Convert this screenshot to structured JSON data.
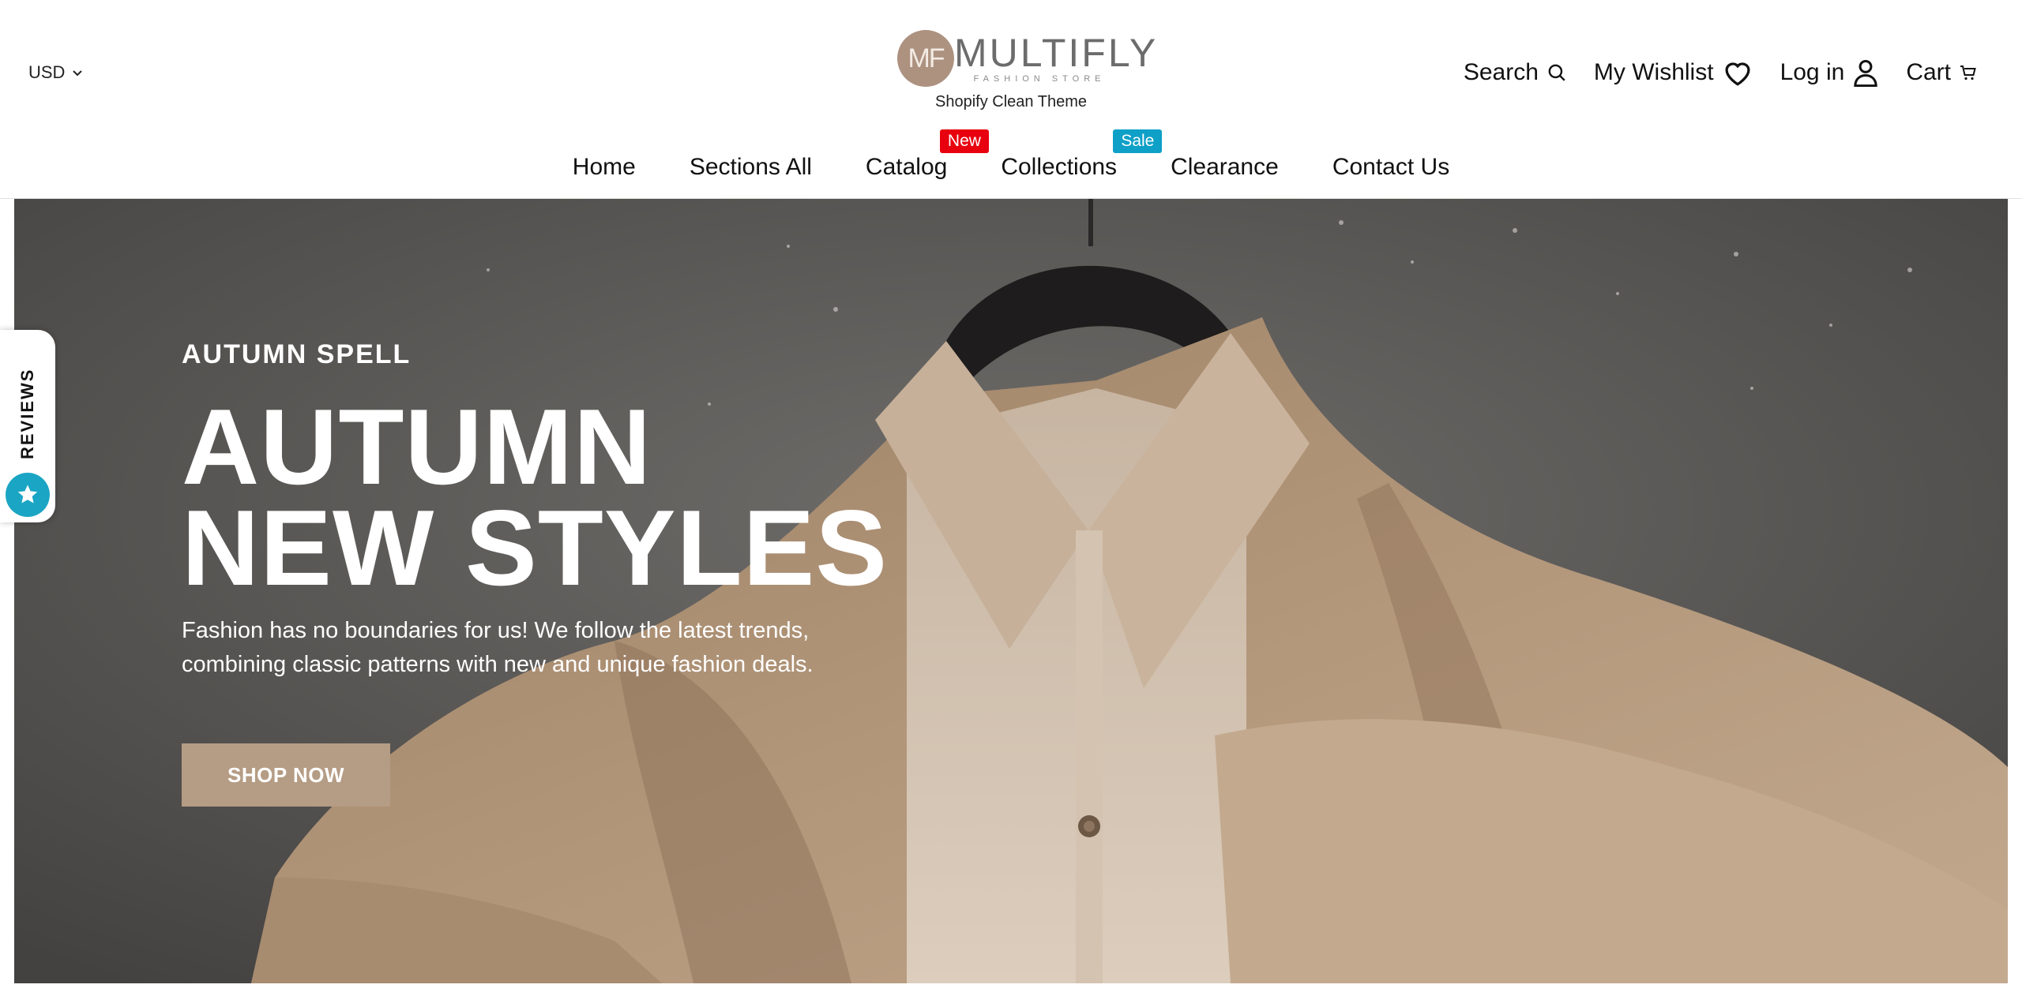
{
  "header": {
    "currency": "USD",
    "logo": {
      "monogram": "MF",
      "name": "MULTIFLY",
      "subtitle": "FASHION STORE"
    },
    "tagline": "Shopify Clean Theme",
    "actions": {
      "search": "Search",
      "wishlist": "My Wishlist",
      "login": "Log in",
      "cart": "Cart"
    }
  },
  "nav": {
    "items": [
      {
        "label": "Home"
      },
      {
        "label": "Sections All"
      },
      {
        "label": "Catalog",
        "badge": "New"
      },
      {
        "label": "Collections",
        "badge": "Sale"
      },
      {
        "label": "Clearance"
      },
      {
        "label": "Contact Us"
      }
    ]
  },
  "hero": {
    "eyebrow": "AUTUMN SPELL",
    "headline_line1": "AUTUMN",
    "headline_line2": "NEW STYLES",
    "subtext_line1": "Fashion has no boundaries for us! We follow the latest trends,",
    "subtext_line2": "combining classic patterns with new and unique fashion deals.",
    "cta": "SHOP NOW"
  },
  "reviews_tab": {
    "label": "REVIEWS"
  },
  "colors": {
    "badge_new": "#e8000e",
    "badge_sale": "#0fa0c8",
    "button": "#b59c84",
    "logo": "#ad9280",
    "reviews_star": "#1aa5c4"
  }
}
